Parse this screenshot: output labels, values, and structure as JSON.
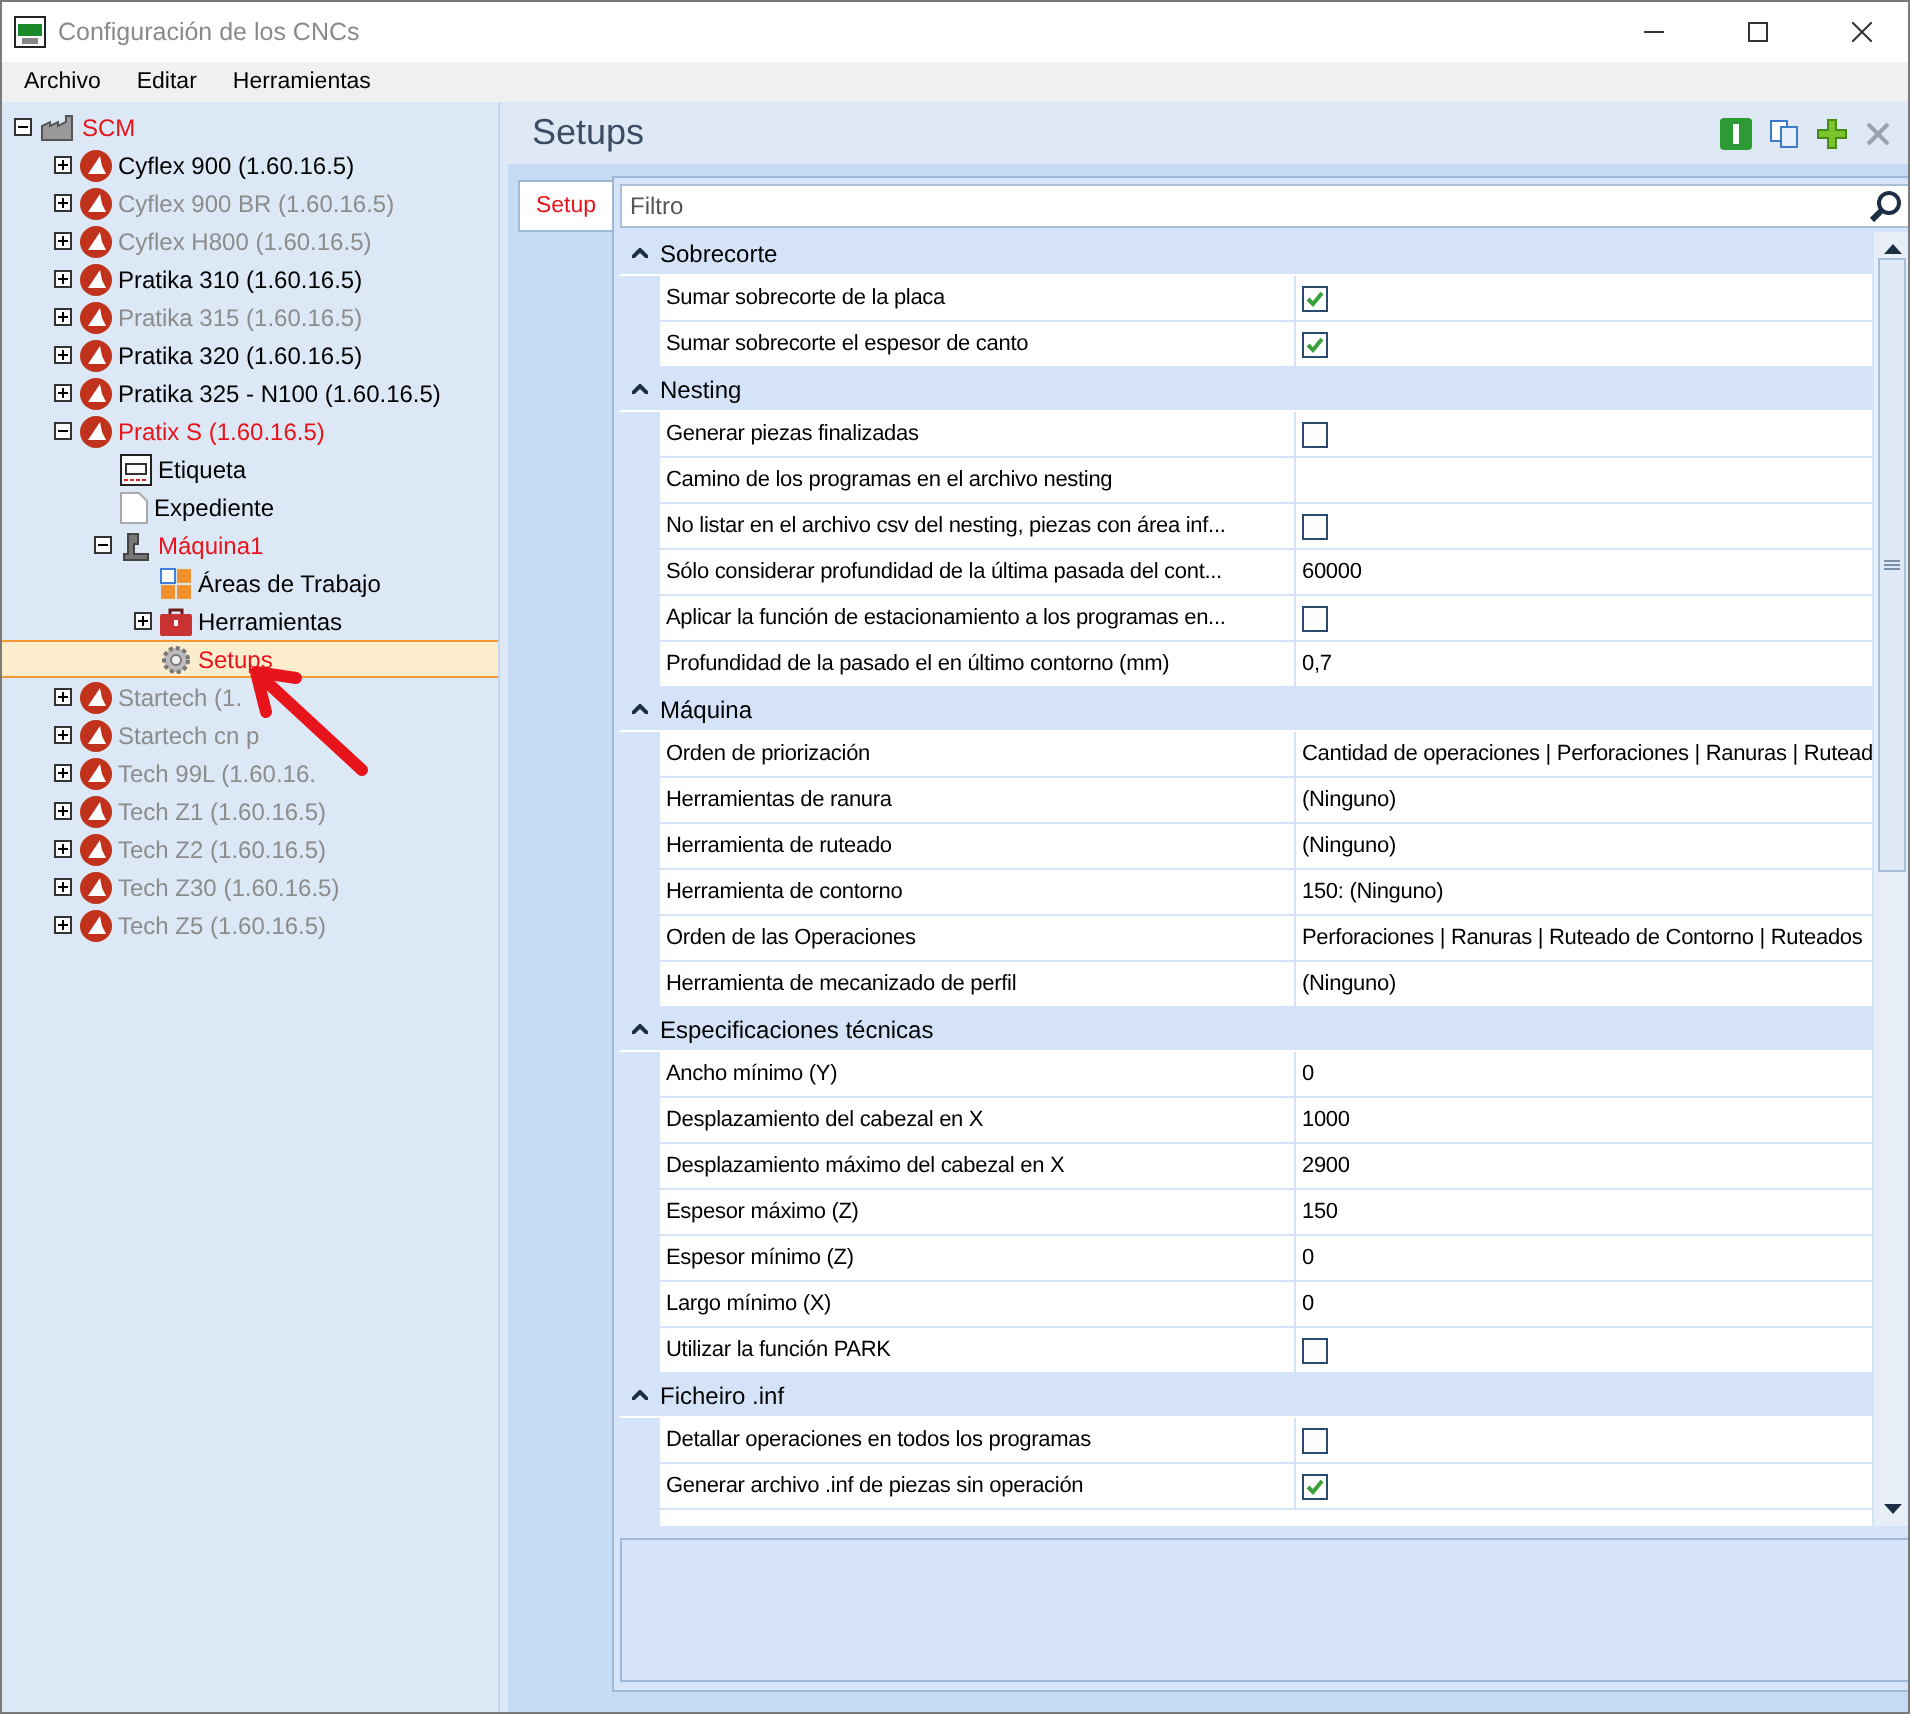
{
  "window": {
    "title": "Configuración de los CNCs"
  },
  "menu": [
    "Archivo",
    "Editar",
    "Herramientas"
  ],
  "tree": [
    {
      "label": "SCM",
      "kind": "factory",
      "expanded": true,
      "highlighted": true,
      "disabled": false,
      "selected": false,
      "children": [
        {
          "label": "Cyflex 900 (1.60.16.5)",
          "kind": "machine",
          "expanded": false,
          "highlighted": false,
          "disabled": false,
          "selected": false
        },
        {
          "label": "Cyflex 900 BR (1.60.16.5)",
          "kind": "machine",
          "expanded": false,
          "highlighted": false,
          "disabled": true,
          "selected": false
        },
        {
          "label": "Cyflex H800 (1.60.16.5)",
          "kind": "machine",
          "expanded": false,
          "highlighted": false,
          "disabled": true,
          "selected": false
        },
        {
          "label": "Pratika 310 (1.60.16.5)",
          "kind": "machine",
          "expanded": false,
          "highlighted": false,
          "disabled": false,
          "selected": false
        },
        {
          "label": "Pratika 315 (1.60.16.5)",
          "kind": "machine",
          "expanded": false,
          "highlighted": false,
          "disabled": true,
          "selected": false
        },
        {
          "label": "Pratika 320 (1.60.16.5)",
          "kind": "machine",
          "expanded": false,
          "highlighted": false,
          "disabled": false,
          "selected": false
        },
        {
          "label": "Pratika 325 - N100 (1.60.16.5)",
          "kind": "machine",
          "expanded": false,
          "highlighted": false,
          "disabled": false,
          "selected": false
        },
        {
          "label": "Pratix S (1.60.16.5)",
          "kind": "machine",
          "expanded": true,
          "highlighted": true,
          "disabled": false,
          "selected": false,
          "children": [
            {
              "label": "Etiqueta",
              "kind": "label",
              "highlighted": false,
              "disabled": false,
              "selected": false
            },
            {
              "label": "Expediente",
              "kind": "file",
              "highlighted": false,
              "disabled": false,
              "selected": false
            },
            {
              "label": "Máquina1",
              "kind": "station",
              "expanded": true,
              "highlighted": true,
              "disabled": false,
              "selected": false,
              "children": [
                {
                  "label": "Áreas de Trabajo",
                  "kind": "areas",
                  "highlighted": false,
                  "disabled": false,
                  "selected": false
                },
                {
                  "label": "Herramientas",
                  "kind": "tools",
                  "expanded": false,
                  "highlighted": false,
                  "disabled": false,
                  "selected": false
                },
                {
                  "label": "Setups",
                  "kind": "setups",
                  "highlighted": true,
                  "disabled": false,
                  "selected": true
                }
              ]
            }
          ]
        },
        {
          "label": "Startech (1.",
          "kind": "machine",
          "expanded": false,
          "highlighted": false,
          "disabled": true,
          "selected": false
        },
        {
          "label": "Startech cn p",
          "kind": "machine",
          "expanded": false,
          "highlighted": false,
          "disabled": true,
          "selected": false
        },
        {
          "label": "Tech 99L (1.60.16.",
          "kind": "machine",
          "expanded": false,
          "highlighted": false,
          "disabled": true,
          "selected": false
        },
        {
          "label": "Tech Z1 (1.60.16.5)",
          "kind": "machine",
          "expanded": false,
          "highlighted": false,
          "disabled": true,
          "selected": false
        },
        {
          "label": "Tech Z2 (1.60.16.5)",
          "kind": "machine",
          "expanded": false,
          "highlighted": false,
          "disabled": true,
          "selected": false
        },
        {
          "label": "Tech Z30 (1.60.16.5)",
          "kind": "machine",
          "expanded": false,
          "highlighted": false,
          "disabled": true,
          "selected": false
        },
        {
          "label": "Tech Z5 (1.60.16.5)",
          "kind": "machine",
          "expanded": false,
          "highlighted": false,
          "disabled": true,
          "selected": false
        }
      ]
    }
  ],
  "panel": {
    "title": "Setups",
    "tabs": [
      {
        "label": "Setup",
        "selected": true
      }
    ],
    "filter": {
      "placeholder": "Filtro"
    }
  },
  "categories": [
    {
      "name": "Sobrecorte",
      "expanded": true,
      "properties": [
        {
          "name": "Sumar sobrecorte de la placa",
          "kind": "check",
          "checked": true
        },
        {
          "name": "Sumar sobrecorte el espesor de canto",
          "kind": "check",
          "checked": true
        }
      ]
    },
    {
      "name": "Nesting",
      "expanded": true,
      "properties": [
        {
          "name": "Generar piezas finalizadas",
          "kind": "check",
          "checked": false
        },
        {
          "name": "Camino de los programas en el archivo nesting",
          "kind": "text"
        },
        {
          "name": "No listar en el archivo csv del nesting, piezas con área inf...",
          "kind": "check",
          "checked": false
        },
        {
          "name": "Sólo considerar profundidad de la última pasada del cont...",
          "kind": "text",
          "value": "60000"
        },
        {
          "name": "Aplicar la función de estacionamiento a los programas en...",
          "kind": "check",
          "checked": false
        },
        {
          "name": "Profundidad de la pasado el en último contorno (mm)",
          "kind": "text",
          "value": "0,7"
        }
      ]
    },
    {
      "name": "Máquina",
      "expanded": true,
      "properties": [
        {
          "name": "Orden de priorización",
          "kind": "text",
          "value": "Cantidad de operaciones | Perforaciones | Ranuras | Rutead"
        },
        {
          "name": "Herramientas de ranura",
          "kind": "text",
          "value": "(Ninguno)"
        },
        {
          "name": "Herramienta de ruteado",
          "kind": "text",
          "value": "(Ninguno)"
        },
        {
          "name": "Herramienta de contorno",
          "kind": "text",
          "value": "150: (Ninguno)"
        },
        {
          "name": "Orden de las Operaciones",
          "kind": "text",
          "value": "Perforaciones | Ranuras | Ruteado de Contorno | Ruteados"
        },
        {
          "name": "Herramienta de mecanizado de perfil",
          "kind": "text",
          "value": "(Ninguno)"
        }
      ]
    },
    {
      "name": "Especificaciones técnicas",
      "expanded": true,
      "properties": [
        {
          "name": "Ancho mínimo (Y)",
          "kind": "text",
          "value": "0"
        },
        {
          "name": "Desplazamiento del cabezal en X",
          "kind": "text",
          "value": "1000"
        },
        {
          "name": "Desplazamiento máximo del cabezal en X",
          "kind": "text",
          "value": "2900"
        },
        {
          "name": "Espesor máximo (Z)",
          "kind": "text",
          "value": "150"
        },
        {
          "name": "Espesor mínimo (Z)",
          "kind": "text",
          "value": "0"
        },
        {
          "name": "Largo mínimo (X)",
          "kind": "text",
          "value": "0"
        },
        {
          "name": "Utilizar la función PARK",
          "kind": "check",
          "checked": false
        }
      ]
    },
    {
      "name": "Ficheiro .inf",
      "expanded": true,
      "properties": [
        {
          "name": "Detallar operaciones en todos los programas",
          "kind": "check",
          "checked": false
        },
        {
          "name": "Generar archivo .inf de piezas sin operación",
          "kind": "check",
          "checked": true
        }
      ]
    }
  ]
}
